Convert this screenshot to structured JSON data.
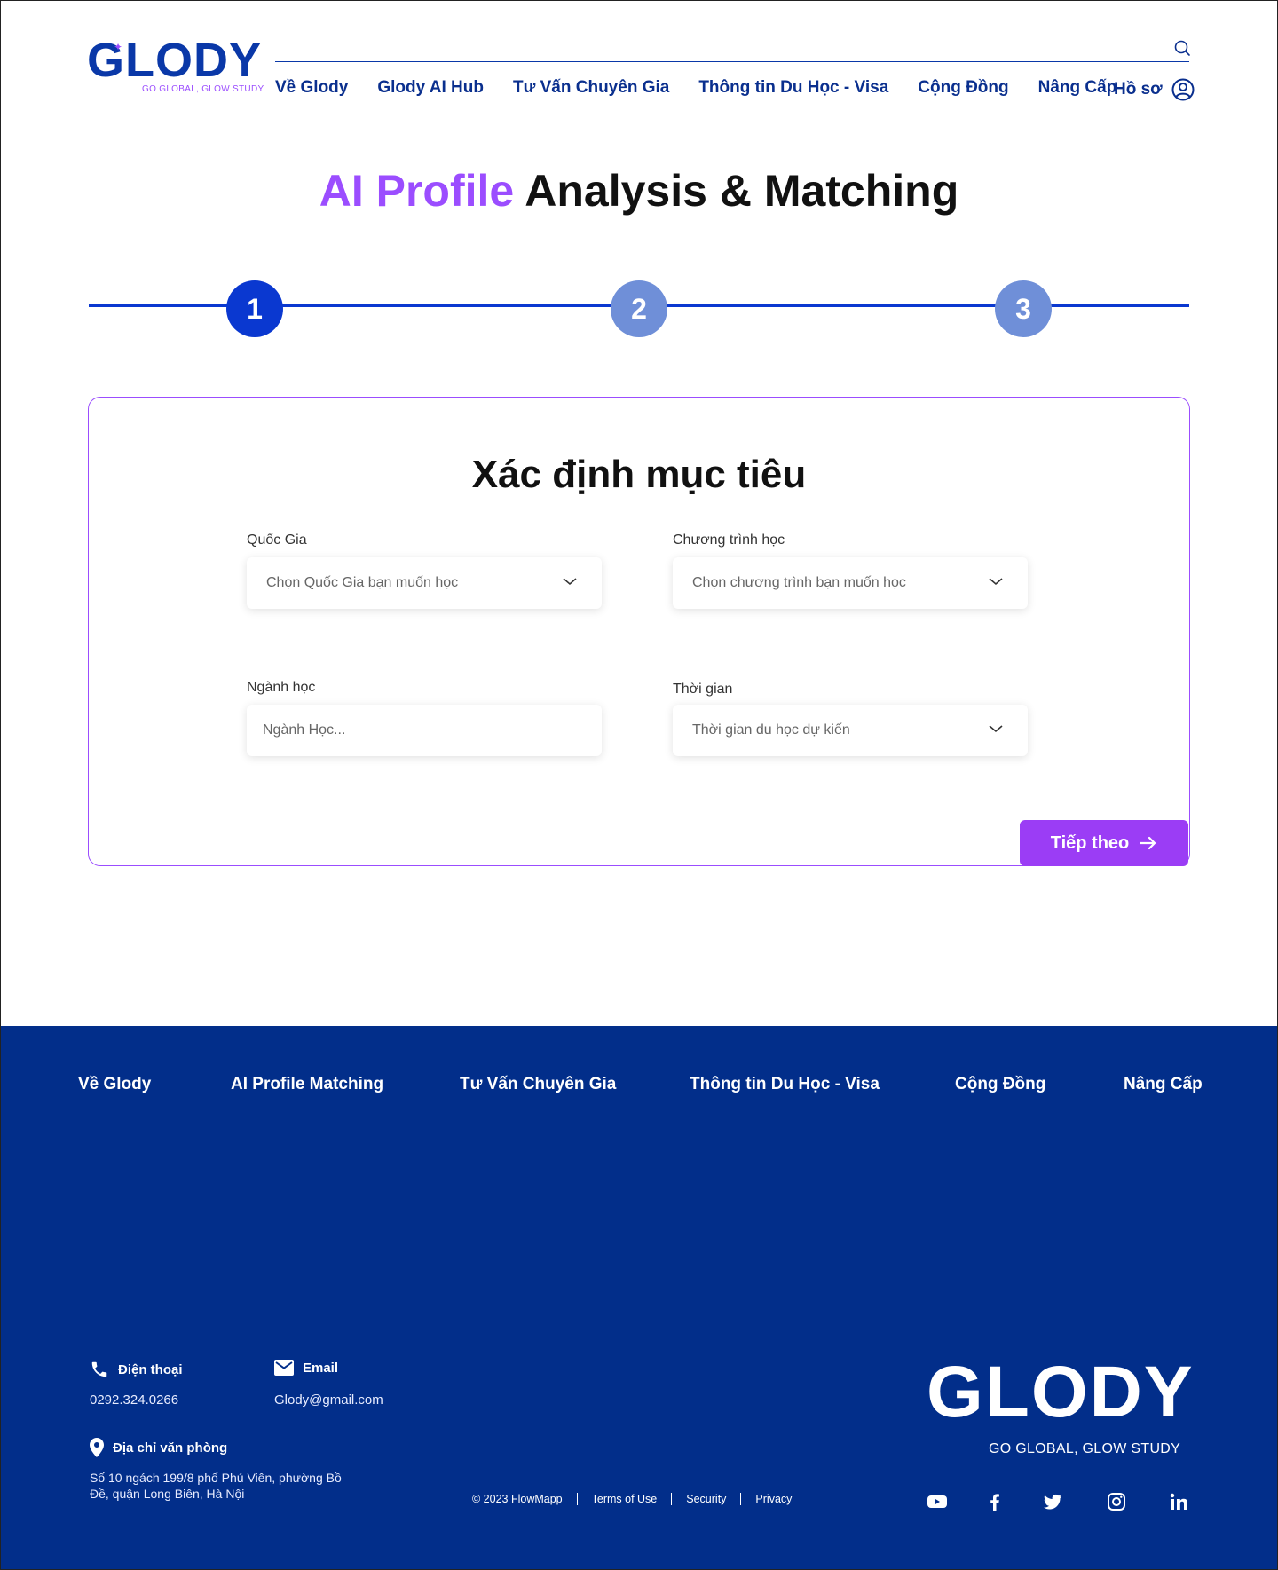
{
  "header": {
    "logo": {
      "word": "GLODY",
      "tagline": "GO GLOBAL, GLOW STUDY"
    },
    "nav": [
      "Về Glody",
      "Glody AI Hub",
      "Tư Vấn Chuyên Gia",
      "Thông tin Du Học - Visa",
      "Cộng Đồng",
      "Nâng Cấp"
    ],
    "profile_label": "Hồ sơ"
  },
  "title": {
    "accent": "AI Profile",
    "rest": "Analysis & Matching"
  },
  "stepper": {
    "steps": [
      "1",
      "2",
      "3"
    ],
    "active": 1
  },
  "form": {
    "title": "Xác định mục tiêu",
    "country": {
      "label": "Quốc Gia",
      "placeholder": "Chọn Quốc Gia bạn muốn học"
    },
    "program": {
      "label": "Chương trình học",
      "placeholder": "Chọn chương trình bạn muốn học"
    },
    "major": {
      "label": "Ngành học",
      "placeholder": "Ngành Học..."
    },
    "time": {
      "label": "Thời gian",
      "placeholder": "Thời gian du học dự kiến"
    },
    "next_label": "Tiếp theo"
  },
  "footer": {
    "nav": [
      "Về Glody",
      "AI Profile Matching",
      "Tư Vấn Chuyên Gia",
      "Thông tin Du Học - Visa",
      "Cộng Đồng",
      "Nâng Cấp"
    ],
    "phone": {
      "label": "Điện thoại",
      "value": "0292.324.0266"
    },
    "email": {
      "label": "Email",
      "value": "Glody@gmail.com"
    },
    "address": {
      "label": "Địa chỉ văn phòng",
      "line1": "Số 10 ngách 199/8 phố Phú Viên, phường Bồ",
      "line2": "Đề, quận Long Biên, Hà Nội"
    },
    "legal": [
      "© 2023 FlowMapp",
      "Terms of Use",
      "Security",
      "Privacy"
    ],
    "logo": {
      "word": "GLODY",
      "tagline": "GO GLOBAL, GLOW STUDY"
    },
    "social_icons": [
      "youtube-icon",
      "facebook-icon",
      "twitter-icon",
      "instagram-icon",
      "linkedin-icon"
    ]
  },
  "colors": {
    "brand_blue": "#0a38a8",
    "accent_purple": "#9b4dff",
    "footer_bg": "#022e8a",
    "step_inactive": "#6f8fd8"
  }
}
